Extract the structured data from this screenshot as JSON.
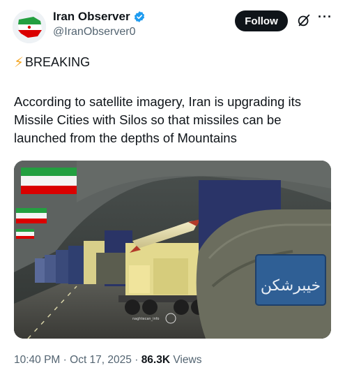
{
  "account": {
    "display_name": "Iran Observer",
    "handle": "@IranObserver0",
    "verified_icon": "verified-badge-icon",
    "avatar": "iran-flag-map-avatar"
  },
  "actions": {
    "follow_label": "Follow",
    "grok_icon": "grok-icon",
    "more_icon": "more-icon"
  },
  "tweet": {
    "breaking_emoji": "⚡",
    "breaking_label": "BREAKING",
    "text": "According to satellite imagery, Iran is upgrading its Missile Cities with Silos so that missiles can be launched from the depths of Mountains"
  },
  "media": {
    "description_icon": "missile-tunnel-photo",
    "sign_text": "خیبرشکن",
    "watermark_text": "naghtecan_info"
  },
  "meta": {
    "time": "10:40 PM",
    "date": "Oct 17, 2025",
    "views_count": "86.3K",
    "views_label": "Views"
  },
  "colors": {
    "text": "#0f1419",
    "secondary": "#536471",
    "verified": "#1d9bf0",
    "follow_bg": "#0f1419"
  }
}
